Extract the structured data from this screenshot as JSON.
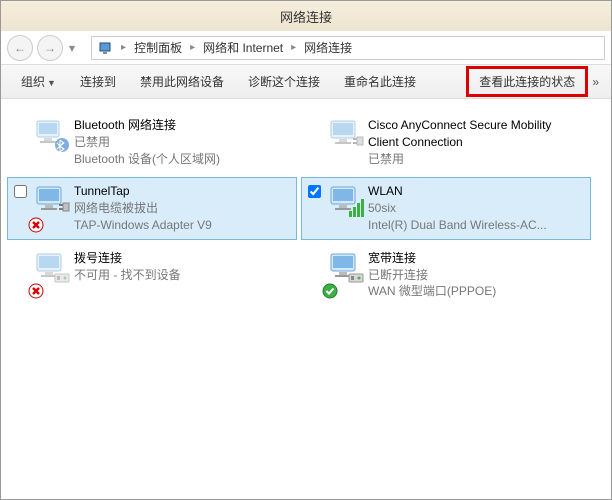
{
  "window": {
    "title": "网络连接"
  },
  "breadcrumb": {
    "items": [
      "控制面板",
      "网络和 Internet",
      "网络连接"
    ]
  },
  "toolbar": {
    "organize": "组织",
    "connect": "连接到",
    "disable": "禁用此网络设备",
    "diagnose": "诊断这个连接",
    "rename": "重命名此连接",
    "viewstatus": "查看此连接的状态"
  },
  "connections": [
    {
      "id": "bluetooth",
      "name": "Bluetooth 网络连接",
      "status": "已禁用",
      "device": "Bluetooth 设备(个人区域网)",
      "icon": "bluetooth",
      "selected": false,
      "checked": null,
      "disabled": true,
      "overlay": null
    },
    {
      "id": "cisco",
      "name": "Cisco AnyConnect Secure Mobility Client Connection",
      "status": "已禁用",
      "device": "",
      "icon": "monitor",
      "selected": false,
      "checked": null,
      "disabled": true,
      "overlay": null
    },
    {
      "id": "tunneltap",
      "name": "TunnelTap",
      "status": "网络电缆被拔出",
      "device": "TAP-Windows Adapter V9",
      "icon": "monitor",
      "selected": true,
      "checked": false,
      "disabled": false,
      "overlay": "error-x"
    },
    {
      "id": "wlan",
      "name": "WLAN",
      "status": "50six",
      "device": "Intel(R) Dual Band Wireless-AC...",
      "icon": "wifi",
      "selected": true,
      "checked": true,
      "disabled": false,
      "overlay": null
    },
    {
      "id": "dialup",
      "name": "拨号连接",
      "status": "不可用 - 找不到设备",
      "device": "",
      "icon": "modem",
      "selected": false,
      "checked": null,
      "disabled": true,
      "overlay": "error-x"
    },
    {
      "id": "broadband",
      "name": "宽带连接",
      "status": "已断开连接",
      "device": "WAN 微型端口(PPPOE)",
      "icon": "modem",
      "selected": false,
      "checked": null,
      "disabled": false,
      "overlay": "check-green"
    }
  ]
}
